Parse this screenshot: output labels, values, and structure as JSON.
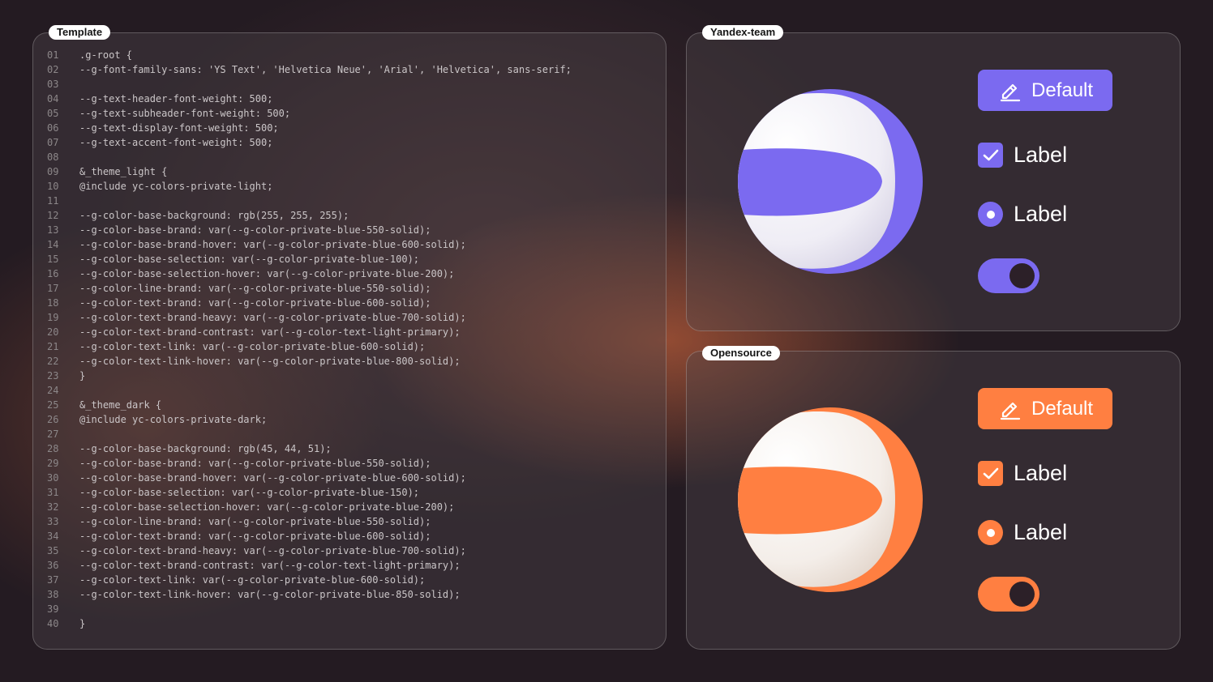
{
  "panels": {
    "template": {
      "tag": "Template",
      "code_lines": [
        {
          "n": "01",
          "t": ".g-root {"
        },
        {
          "n": "02",
          "t": "--g-font-family-sans: 'YS Text', 'Helvetica Neue', 'Arial', 'Helvetica', sans-serif;"
        },
        {
          "n": "03",
          "t": ""
        },
        {
          "n": "04",
          "t": "--g-text-header-font-weight: 500;"
        },
        {
          "n": "05",
          "t": "--g-text-subheader-font-weight: 500;"
        },
        {
          "n": "06",
          "t": "--g-text-display-font-weight: 500;"
        },
        {
          "n": "07",
          "t": "--g-text-accent-font-weight: 500;"
        },
        {
          "n": "08",
          "t": ""
        },
        {
          "n": "09",
          "t": "&_theme_light {"
        },
        {
          "n": "10",
          "t": "@include yc-colors-private-light;"
        },
        {
          "n": "11",
          "t": ""
        },
        {
          "n": "12",
          "t": "--g-color-base-background: rgb(255, 255, 255);"
        },
        {
          "n": "13",
          "t": "--g-color-base-brand: var(--g-color-private-blue-550-solid);"
        },
        {
          "n": "14",
          "t": "--g-color-base-brand-hover: var(--g-color-private-blue-600-solid);"
        },
        {
          "n": "15",
          "t": "--g-color-base-selection: var(--g-color-private-blue-100);"
        },
        {
          "n": "16",
          "t": "--g-color-base-selection-hover: var(--g-color-private-blue-200);"
        },
        {
          "n": "17",
          "t": "--g-color-line-brand: var(--g-color-private-blue-550-solid);"
        },
        {
          "n": "18",
          "t": "--g-color-text-brand: var(--g-color-private-blue-600-solid);"
        },
        {
          "n": "19",
          "t": "--g-color-text-brand-heavy: var(--g-color-private-blue-700-solid);"
        },
        {
          "n": "20",
          "t": "--g-color-text-brand-contrast: var(--g-color-text-light-primary);"
        },
        {
          "n": "21",
          "t": "--g-color-text-link: var(--g-color-private-blue-600-solid);"
        },
        {
          "n": "22",
          "t": "--g-color-text-link-hover: var(--g-color-private-blue-800-solid);"
        },
        {
          "n": "23",
          "t": "}"
        },
        {
          "n": "24",
          "t": ""
        },
        {
          "n": "25",
          "t": "&_theme_dark {"
        },
        {
          "n": "26",
          "t": "@include yc-colors-private-dark;"
        },
        {
          "n": "27",
          "t": ""
        },
        {
          "n": "28",
          "t": "--g-color-base-background: rgb(45, 44, 51);"
        },
        {
          "n": "29",
          "t": "--g-color-base-brand: var(--g-color-private-blue-550-solid);"
        },
        {
          "n": "30",
          "t": "--g-color-base-brand-hover: var(--g-color-private-blue-600-solid);"
        },
        {
          "n": "31",
          "t": "--g-color-base-selection: var(--g-color-private-blue-150);"
        },
        {
          "n": "32",
          "t": "--g-color-base-selection-hover: var(--g-color-private-blue-200);"
        },
        {
          "n": "33",
          "t": "--g-color-line-brand: var(--g-color-private-blue-550-solid);"
        },
        {
          "n": "34",
          "t": "--g-color-text-brand: var(--g-color-private-blue-600-solid);"
        },
        {
          "n": "35",
          "t": "--g-color-text-brand-heavy: var(--g-color-private-blue-700-solid);"
        },
        {
          "n": "36",
          "t": "--g-color-text-brand-contrast: var(--g-color-text-light-primary);"
        },
        {
          "n": "37",
          "t": "--g-color-text-link: var(--g-color-private-blue-600-solid);"
        },
        {
          "n": "38",
          "t": "--g-color-text-link-hover: var(--g-color-private-blue-850-solid);"
        },
        {
          "n": "39",
          "t": ""
        },
        {
          "n": "40",
          "t": "}"
        }
      ]
    },
    "yandex_team": {
      "tag": "Yandex-team",
      "accent": "#7b6af0",
      "button_label": "Default",
      "button_icon": "pencil-icon",
      "checkbox_label": "Label",
      "checkbox_checked": true,
      "radio_label": "Label",
      "radio_selected": true,
      "toggle_on": true
    },
    "opensource": {
      "tag": "Opensource",
      "accent": "#ff7f41",
      "button_label": "Default",
      "button_icon": "pencil-icon",
      "checkbox_label": "Label",
      "checkbox_checked": true,
      "radio_label": "Label",
      "radio_selected": true,
      "toggle_on": true
    }
  }
}
